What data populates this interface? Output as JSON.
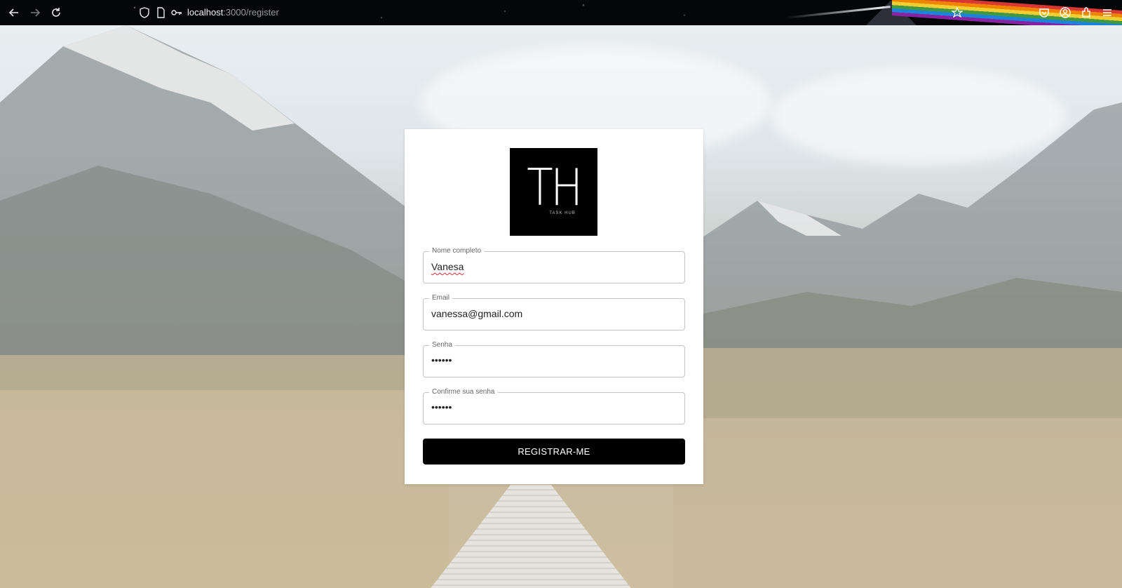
{
  "browser": {
    "url_host": "localhost",
    "url_path": ":3000/register",
    "back_icon": "arrow-left",
    "forward_icon": "arrow-right",
    "reload_icon": "reload",
    "shield_icon": "tracking-protection",
    "page_icon": "page",
    "key_icon": "key",
    "star_icon": "bookmark-star",
    "pocket_icon": "pocket",
    "account_icon": "account",
    "extensions_icon": "extensions",
    "menu_icon": "hamburger-menu"
  },
  "logo": {
    "letters": "TH",
    "subtitle": "TASK HUB"
  },
  "form": {
    "name": {
      "label": "Nome completo",
      "value": "Vanesa"
    },
    "email": {
      "label": "Email",
      "value": "vanessa@gmail.com"
    },
    "password": {
      "label": "Senha",
      "value": "••••••"
    },
    "confirm": {
      "label": "Confirme sua senha",
      "value": "••••••"
    },
    "submit_label": "REGISTRAR-ME"
  },
  "colors": {
    "button_bg": "#000000",
    "card_bg": "#ffffff",
    "field_border": "#c4c4c4"
  }
}
